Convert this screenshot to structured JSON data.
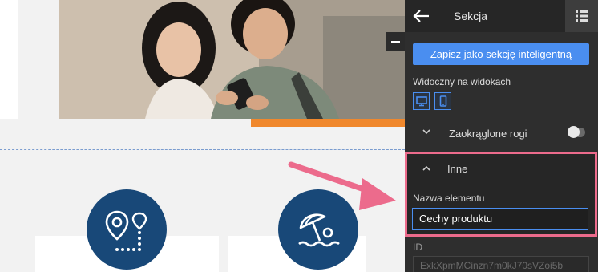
{
  "panel": {
    "title": "Sekcja",
    "save_smart_label": "Zapisz jako sekcję inteligentną",
    "visible_on_views_label": "Widoczny na widokach",
    "view_icons": [
      "desktop-icon",
      "mobile-icon"
    ],
    "rounded_corners_label": "Zaokrąglone rogi",
    "rounded_corners_enabled": false,
    "other_section_label": "Inne",
    "element_name_label": "Nazwa elementu",
    "element_name_value": "Cechy produktu",
    "id_label": "ID",
    "id_value": "ExkXpmMCinzn7m0kJ70sVZoi5b"
  },
  "canvas": {
    "feature_icons": [
      "route-map-pin-icon",
      "beach-umbrella-icon"
    ]
  },
  "colors": {
    "accent_blue": "#4a8ef0",
    "feature_circle": "#184878",
    "orange_bar": "#f0882d",
    "highlight_pink": "#ec6b8c",
    "panel_bg": "#2e2e2e"
  }
}
